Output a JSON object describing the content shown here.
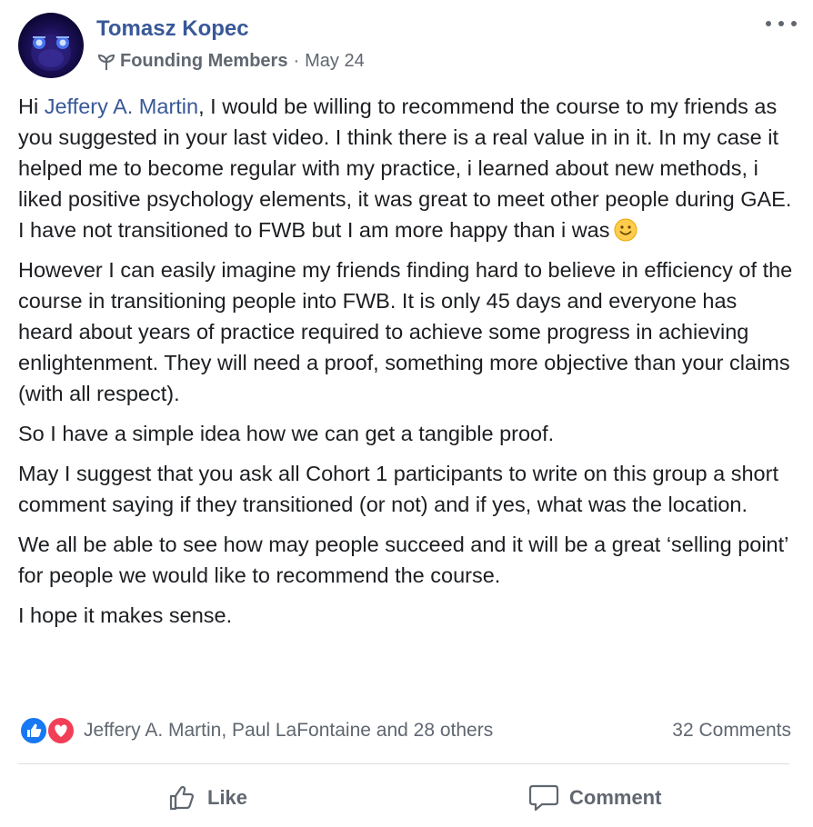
{
  "post": {
    "author": "Tomasz Kopec",
    "group": "Founding Members",
    "separator": "·",
    "date": "May 24",
    "mention": "Jeffery A. Martin",
    "p1_before_mention": "Hi ",
    "p1_after_mention": ", I would be willing to recommend the course to my friends as you suggested in your last video. I think there is a real value in in it. In my case it helped me to become regular with my practice, i learned about new methods, i liked positive psychology elements, it was great to meet other people during GAE. I have not transitioned to FWB but I am more happy than i was",
    "p2": "However I can easily imagine my friends finding hard to believe in efficiency of the course in transitioning people into FWB. It is only 45 days and everyone has heard about years of practice required to achieve some progress in achieving enlightenment. They will need a proof, something more objective than your claims (with all respect).",
    "p3": "So I have a simple idea how we can get a tangible proof.",
    "p4": "May I suggest that you ask all Cohort 1 participants to write on this group a short comment saying if they transitioned (or not) and if yes, what was the location.",
    "p5": "We all be able to see how may people succeed and it will be a great ‘selling point’ for people we would like to recommend the course.",
    "p6": "I hope it makes sense."
  },
  "reactions": {
    "summary": "Jeffery A. Martin, Paul LaFontaine and 28 others",
    "comments": "32 Comments",
    "icons": [
      "like-icon",
      "love-icon"
    ]
  },
  "actions": {
    "like_label": "Like",
    "comment_label": "Comment"
  },
  "colors": {
    "link": "#385898",
    "secondary": "#606770",
    "like_blue": "#1877f2",
    "love_red": "#f33e58"
  }
}
